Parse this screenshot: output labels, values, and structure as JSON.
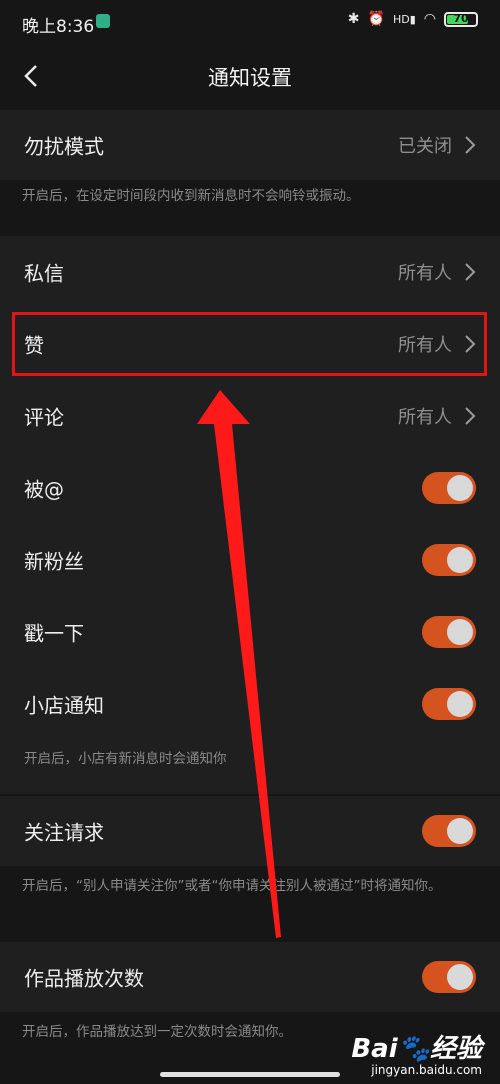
{
  "status_bar": {
    "time": "晚上8:36",
    "icons": [
      "bluetooth-icon",
      "alarm-icon",
      "signal-icon",
      "wifi-icon"
    ],
    "network_label": "HD",
    "battery": "70"
  },
  "header": {
    "title": "通知设置"
  },
  "dnd": {
    "label": "勿扰模式",
    "value": "已关闭",
    "hint": "开启后，在设定时间段内收到新消息时不会响铃或振动。"
  },
  "items": [
    {
      "label": "私信",
      "value": "所有人"
    },
    {
      "label": "赞",
      "value": "所有人"
    },
    {
      "label": "评论",
      "value": "所有人"
    }
  ],
  "toggles": [
    {
      "label": "被@",
      "on": true
    },
    {
      "label": "新粉丝",
      "on": true
    },
    {
      "label": "戳一下",
      "on": true
    },
    {
      "label": "小店通知",
      "on": true
    }
  ],
  "shop_hint": "开启后，小店有新消息时会通知你",
  "follow": {
    "label": "关注请求",
    "on": true,
    "hint": "开启后，“别人申请关注你”或者“你申请关注别人被通过”时将通知你。"
  },
  "plays": {
    "label": "作品播放次数",
    "on": true,
    "hint": "开启后，作品播放达到一定次数时会通知你。"
  },
  "watermark": {
    "logo": "Bai🐾经验",
    "sub": "jingyan.baidu.com"
  },
  "colors": {
    "toggle_on": "#d5531f",
    "highlight": "#e11414",
    "arrow": "#ff1a1a"
  }
}
